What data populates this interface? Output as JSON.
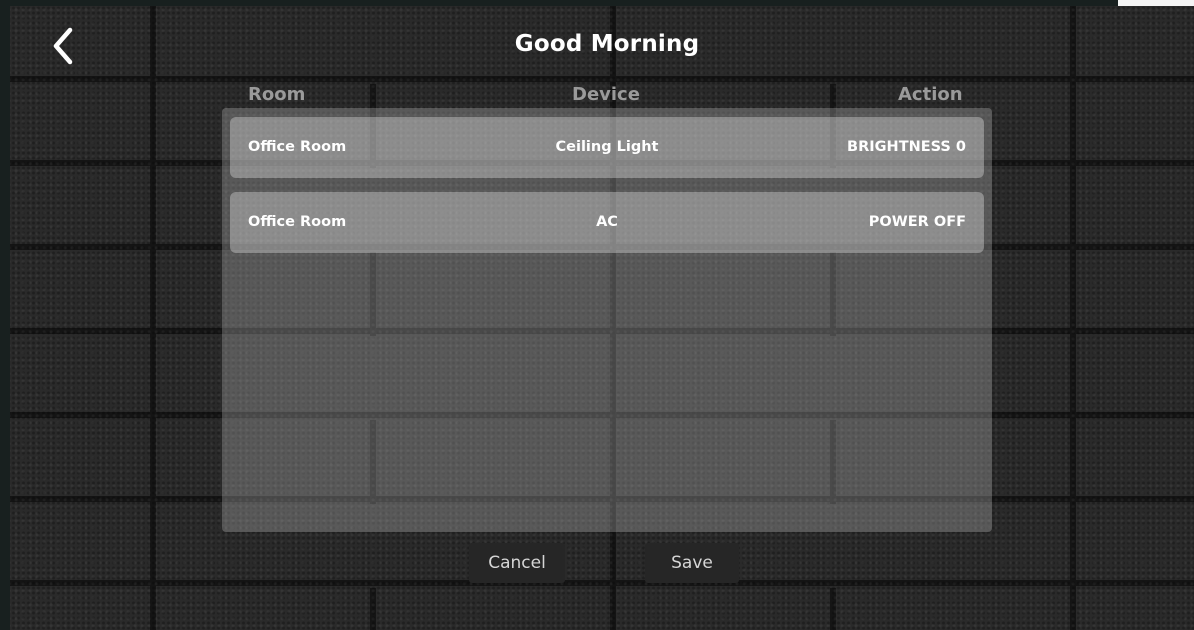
{
  "header": {
    "title": "Good Morning",
    "back_icon": "chevron-left-icon"
  },
  "table": {
    "columns": [
      "Room",
      "Device",
      "Action"
    ],
    "rows": [
      {
        "room": "Office Room",
        "device": "Ceiling Light",
        "action": "BRIGHTNESS 0"
      },
      {
        "room": "Office Room",
        "device": "AC",
        "action": "POWER OFF"
      }
    ]
  },
  "footer": {
    "cancel_label": "Cancel",
    "save_label": "Save"
  },
  "colors": {
    "background": "#2a2a2a",
    "text": "#ffffff",
    "header_text": "#9a9a9a",
    "button_bg": "#262626"
  }
}
